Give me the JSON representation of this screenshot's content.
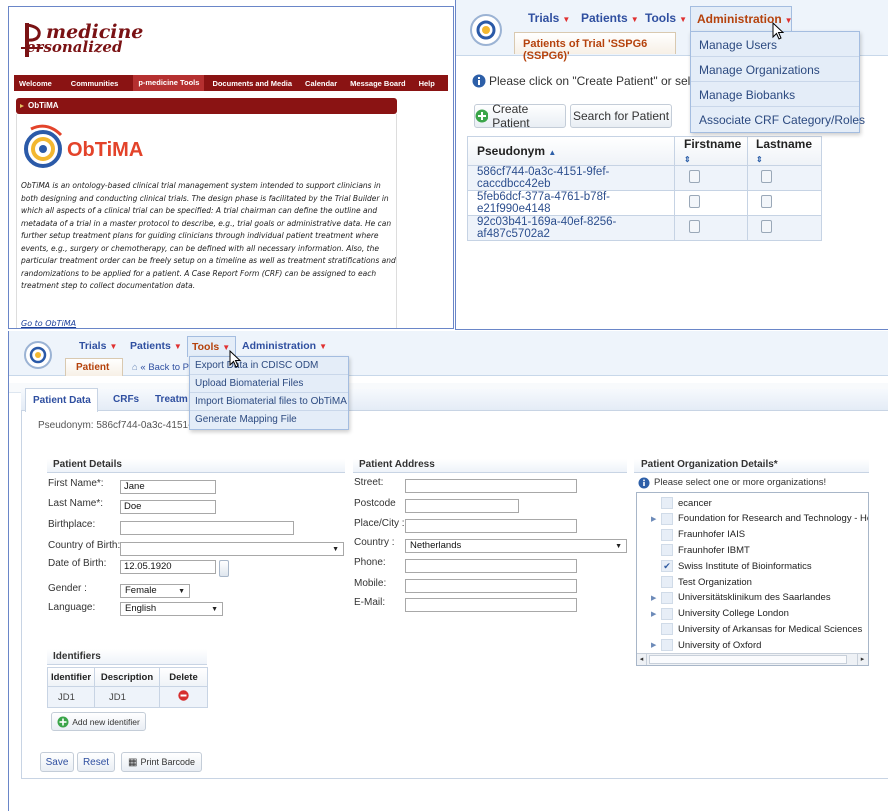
{
  "p_medicine": {
    "logo_top": "medicine",
    "logo_bottom": "ersonalized",
    "nav": [
      "Welcome",
      "Communities",
      "p-medicine Tools",
      "Documents and Media",
      "Calendar",
      "Message Board",
      "Help"
    ],
    "obtima_header": "ObTiMA",
    "obtima_logo": "ObTiMA",
    "description": "ObTiMA is an ontology-based clinical trial management system intended to support clinicians in both designing and conducting clinical trials. The design phase is facilitated by the Trial Builder in which all aspects of a clinical trial can be specified: A trial chairman can define the outline and metadata of a trial in a master protocol to describe, e.g., trial goals or administrative data. He can further setup treatment plans for guiding clinicians through individual patient treatment where events, e.g., surgery or chemotherapy, can be defined with all necessary information. Also, the particular treatment order can be freely setup on a timeline as well as treatment stratifications and randomizations to be applied for a patient. A Case Report Form (CRF) can be assigned to each treatment step to collect documentation data.",
    "link": "Go to ObTiMA"
  },
  "trial_panel": {
    "nav": [
      "Trials",
      "Patients",
      "Tools",
      "Administration"
    ],
    "tab": "Patients of Trial 'SSPG6 (SSPG6)'",
    "info": "Please click on \"Create Patient\" or select a pati",
    "create_button": "Create Patient",
    "search_button": "Search for Patient",
    "admin_menu": [
      "Manage Users",
      "Manage Organizations",
      "Manage Biobanks",
      "Associate CRF Category/Roles"
    ],
    "columns": [
      "Pseudonym",
      "Firstname",
      "Lastname"
    ],
    "rows": [
      "586cf744-0a3c-4151-9fef-caccdbcc42eb",
      "5feb6dcf-377a-4761-b78f-e21f990e4148",
      "92c03b41-169a-40ef-8256-af487c5702a2"
    ]
  },
  "patient_panel": {
    "nav": [
      "Trials",
      "Patients",
      "Tools",
      "Administration"
    ],
    "tab": "Patient",
    "back": "Back to P",
    "tools_menu": [
      "Export Data in CDISC ODM",
      "Upload Biomaterial Files",
      "Import Biomaterial files to ObTiMA",
      "Generate Mapping File"
    ],
    "tabs": [
      "Patient Data",
      "CRFs",
      "Treatm"
    ],
    "pseudonym": "Pseudonym: 586cf744-0a3c-4151-",
    "details_title": "Patient Details",
    "details": {
      "first_name_label": "First Name*:",
      "first_name": "Jane",
      "last_name_label": "Last Name*:",
      "last_name": "Doe",
      "birthplace_label": "Birthplace:",
      "country_label": "Country of Birth:",
      "dob_label": "Date of Birth:",
      "dob": "12.05.1920",
      "gender_label": "Gender :",
      "gender": "Female",
      "language_label": "Language:",
      "language": "English"
    },
    "address_title": "Patient Address",
    "address": {
      "street": "Street:",
      "postcode": "Postcode",
      "city": "Place/City :",
      "country": "Country :",
      "country_value": "Netherlands",
      "phone": "Phone:",
      "mobile": "Mobile:",
      "email": "E-Mail:"
    },
    "org_title": "Patient Organization Details*",
    "org_info": "Please select one or more organizations!",
    "orgs": [
      {
        "name": "ecancer",
        "expand": false,
        "checked": false
      },
      {
        "name": "Foundation for Research and Technology - Hella",
        "expand": true,
        "checked": false
      },
      {
        "name": "Fraunhofer IAIS",
        "expand": false,
        "checked": false
      },
      {
        "name": "Fraunhofer IBMT",
        "expand": false,
        "checked": false
      },
      {
        "name": "Swiss Institute of Bioinformatics",
        "expand": false,
        "checked": true
      },
      {
        "name": "Test Organization",
        "expand": false,
        "checked": false
      },
      {
        "name": "Universitätsklinikum des Saarlandes",
        "expand": true,
        "checked": false
      },
      {
        "name": "University College London",
        "expand": true,
        "checked": false
      },
      {
        "name": "University of Arkansas for Medical Sciences",
        "expand": false,
        "checked": false
      },
      {
        "name": "University of Oxford",
        "expand": true,
        "checked": false
      }
    ],
    "identifiers_title": "Identifiers",
    "id_columns": [
      "Identifier",
      "Description",
      "Delete"
    ],
    "id_row": [
      "JD1",
      "JD1"
    ],
    "add_identifier": "Add new identifier",
    "save": "Save",
    "reset": "Reset",
    "print_barcode": "Print Barcode"
  },
  "colors": {
    "brand": "#8a1313",
    "nav_text": "#2f4fa0",
    "tab_text": "#b5420c",
    "link": "#1a3e99"
  },
  "icons": [
    "obtima-logo-icon",
    "info-icon",
    "plus-icon",
    "sort-asc-icon",
    "sort-both-icon",
    "bin-icon",
    "delete-icon",
    "barcode-icon",
    "cursor-icon",
    "home-icon",
    "calendar-icon",
    "checkmark-icon"
  ]
}
